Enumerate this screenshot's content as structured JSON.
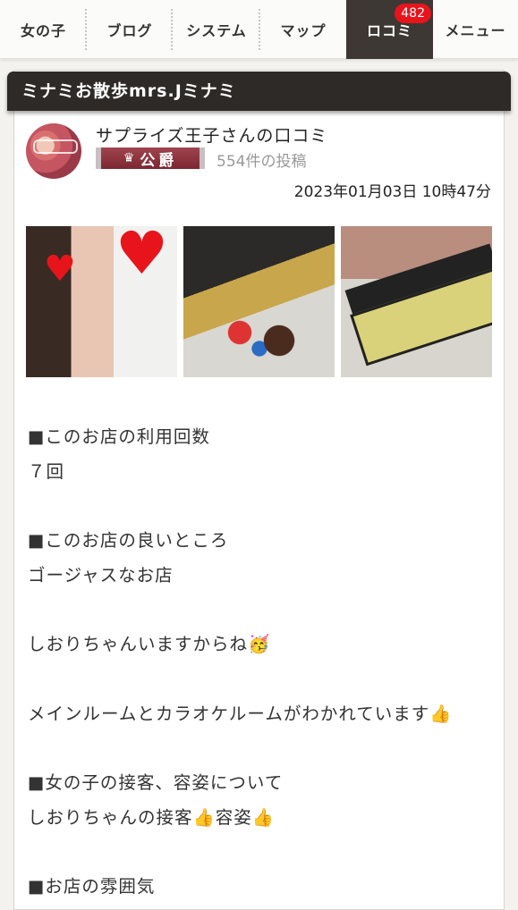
{
  "nav": {
    "items": [
      {
        "label": "女の子"
      },
      {
        "label": "ブログ"
      },
      {
        "label": "システム"
      },
      {
        "label": "マップ"
      },
      {
        "label": "ロコミ",
        "badge": "482"
      },
      {
        "label": "メニュー"
      }
    ]
  },
  "header": {
    "title": "ミナミお散歩mrs.Jミナミ"
  },
  "review": {
    "reviewer": "サプライズ王子さんの口コミ",
    "rank": "公爵",
    "post_count": "554件の投稿",
    "date": "2023年01月03日 10時47分"
  },
  "body": {
    "lines": [
      "■このお店の利用回数",
      "７回",
      "",
      "■このお店の良いところ",
      "ゴージャスなお店",
      "",
      "しおりちゃんいますからね",
      "",
      "メインルームとカラオケルームがわかれています",
      "",
      "■女の子の接客、容姿について",
      "しおりちゃんの接客",
      "容姿",
      "",
      "■お店の雰囲気"
    ]
  },
  "colors": {
    "accent": "#e8141c",
    "dark": "#2e2a27",
    "rank": "#7b2732"
  },
  "icons": {
    "thumbs_up": "👍",
    "party": "🥳",
    "crown": "♛"
  }
}
